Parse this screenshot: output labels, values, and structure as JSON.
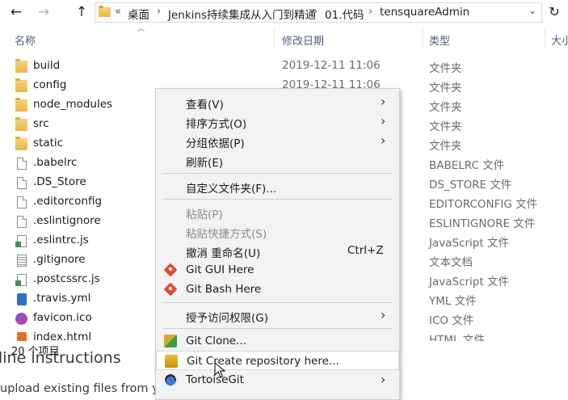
{
  "nav": {
    "back": "←",
    "forward": "→",
    "up": "↑",
    "refresh": "↻",
    "dropdown": "⌄",
    "overflow": "«",
    "breadcrumbs": [
      "桌面",
      "Jenkins持续集成从入门到精通",
      "01.代码",
      "tensquareAdmin"
    ],
    "separator": "›"
  },
  "columns": {
    "name": "名称",
    "modified": "修改日期",
    "type": "类型",
    "size": "大小"
  },
  "files": [
    {
      "name": "build",
      "date": "2019-12-11 11:06",
      "type": "文件夹",
      "icon": "folder"
    },
    {
      "name": "config",
      "date": "2019-12-11 11:06",
      "type": "文件夹",
      "icon": "folder"
    },
    {
      "name": "node_modules",
      "date": "",
      "type": "文件夹",
      "icon": "folder"
    },
    {
      "name": "src",
      "date": "",
      "type": "文件夹",
      "icon": "folder"
    },
    {
      "name": "static",
      "date": "",
      "type": "文件夹",
      "icon": "folder"
    },
    {
      "name": ".babelrc",
      "date": "",
      "type": "BABELRC 文件",
      "icon": "file"
    },
    {
      "name": ".DS_Store",
      "date": "",
      "type": "DS_STORE 文件",
      "icon": "file"
    },
    {
      "name": ".editorconfig",
      "date": "",
      "type": "EDITORCONFIG 文件",
      "icon": "file"
    },
    {
      "name": ".eslintignore",
      "date": "",
      "type": "ESLINTIGNORE 文件",
      "icon": "file"
    },
    {
      "name": ".eslintrc.js",
      "date": "",
      "type": "JavaScript 文件",
      "icon": "js"
    },
    {
      "name": ".gitignore",
      "date": "",
      "type": "文本文档",
      "icon": "txt"
    },
    {
      "name": ".postcssrc.js",
      "date": "",
      "type": "JavaScript 文件",
      "icon": "js"
    },
    {
      "name": ".travis.yml",
      "date": "",
      "type": "YML 文件",
      "icon": "yml"
    },
    {
      "name": "favicon.ico",
      "date": "",
      "type": "ICO 文件",
      "icon": "ico"
    },
    {
      "name": "index.html",
      "date": "",
      "type": "HTML 文件",
      "icon": "html"
    }
  ],
  "status": {
    "count": "20 个项目"
  },
  "background": {
    "heading": "line instructions",
    "line": "upload existing files from yo"
  },
  "menu": {
    "items": [
      {
        "label": "查看(V)",
        "shortcut": "",
        "submenu": true,
        "disabled": false,
        "icon": ""
      },
      {
        "label": "排序方式(O)",
        "shortcut": "",
        "submenu": true,
        "disabled": false,
        "icon": ""
      },
      {
        "label": "分组依据(P)",
        "shortcut": "",
        "submenu": true,
        "disabled": false,
        "icon": ""
      },
      {
        "label": "刷新(E)",
        "shortcut": "",
        "submenu": false,
        "disabled": false,
        "icon": ""
      },
      {
        "sep": true
      },
      {
        "label": "自定义文件夹(F)...",
        "shortcut": "",
        "submenu": false,
        "disabled": false,
        "icon": ""
      },
      {
        "sep": true
      },
      {
        "label": "粘贴(P)",
        "shortcut": "",
        "submenu": false,
        "disabled": true,
        "icon": ""
      },
      {
        "label": "粘贴快捷方式(S)",
        "shortcut": "",
        "submenu": false,
        "disabled": true,
        "icon": ""
      },
      {
        "label": "撤消 重命名(U)",
        "shortcut": "Ctrl+Z",
        "submenu": false,
        "disabled": false,
        "icon": ""
      },
      {
        "label": "Git GUI Here",
        "shortcut": "",
        "submenu": false,
        "disabled": false,
        "icon": "git"
      },
      {
        "label": "Git Bash Here",
        "shortcut": "",
        "submenu": false,
        "disabled": false,
        "icon": "git"
      },
      {
        "sep": true
      },
      {
        "label": "授予访问权限(G)",
        "shortcut": "",
        "submenu": true,
        "disabled": false,
        "icon": ""
      },
      {
        "sep": true
      },
      {
        "label": "Git Clone...",
        "shortcut": "",
        "submenu": false,
        "disabled": false,
        "icon": "clone"
      },
      {
        "label": "Git Create repository here...",
        "shortcut": "",
        "submenu": false,
        "disabled": false,
        "icon": "create",
        "hover": true
      },
      {
        "label": "TortoiseGit",
        "shortcut": "",
        "submenu": true,
        "disabled": false,
        "icon": "tortoise"
      }
    ],
    "submenu_arrow": "›"
  }
}
